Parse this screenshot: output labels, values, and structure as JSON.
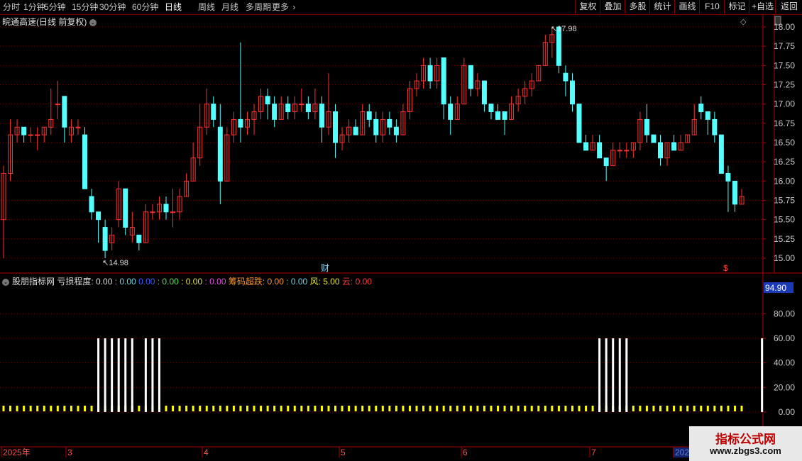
{
  "toolbar": {
    "left_tabs": [
      "分时",
      "1分钟",
      "5分钟",
      "15分钟",
      "30分钟",
      "60分钟",
      "日线",
      "周线",
      "月线",
      "多周期",
      "更多"
    ],
    "active_tab": "日线",
    "right_buttons": [
      "复权",
      "叠加",
      "多股",
      "统计",
      "画线",
      "F10",
      "标记",
      "+自选",
      "返回"
    ]
  },
  "main_chart": {
    "title": "皖通高速(日线 前复权)",
    "high_label": "17.98",
    "low_label": "14.98",
    "event_marker": "财",
    "dollar_marker": "$",
    "y_ticks": [
      "18.00",
      "17.75",
      "17.50",
      "17.25",
      "17.00",
      "16.75",
      "16.50",
      "16.25",
      "16.00",
      "15.75",
      "15.50",
      "15.25",
      "15.00"
    ]
  },
  "indicator": {
    "name": "股朋指标网",
    "items": [
      {
        "label": "亏损程度:",
        "value": "0.00",
        "color": "#dddddd"
      },
      {
        "label": ":",
        "value": "0.00",
        "color": "#6fd6e8"
      },
      {
        "label": "",
        "value": "0.00",
        "color": "#3b5cff"
      },
      {
        "label": ":",
        "value": "0.00",
        "color": "#5fdc5f"
      },
      {
        "label": ":",
        "value": "0.00",
        "color": "#e6e64a"
      },
      {
        "label": ":",
        "value": "0.00",
        "color": "#e04ae0"
      },
      {
        "label": "筹码超跌:",
        "value": "0.00",
        "color": "#ff9a2a"
      },
      {
        "label": ":",
        "value": "0.00",
        "color": "#6fd6e8"
      },
      {
        "label": "风:",
        "value": "5.00",
        "color": "#e6e64a"
      },
      {
        "label": "云:",
        "value": "0.00",
        "color": "#ff3a3a"
      }
    ],
    "current_value": "94.90",
    "y_ticks": [
      "80.00",
      "60.00",
      "40.00",
      "20.00",
      "0.00"
    ]
  },
  "x_axis": {
    "labels": [
      "2025年",
      "3",
      "4",
      "5",
      "6",
      "7",
      "202"
    ]
  },
  "watermark": {
    "title": "指标公式网",
    "url": "www.zbgs3.com"
  },
  "colors": {
    "up": "#ff3030",
    "down": "#54ffff",
    "grid": "#6a0000",
    "border": "#b00000",
    "spike": "#ffffff",
    "base_marker": "#ffff00"
  },
  "chart_data": {
    "type": "candlestick",
    "title": "皖通高速(日线 前复权)",
    "x_range": [
      "2025-01",
      "2025-07"
    ],
    "ylim": [
      14.9,
      18.1
    ],
    "candles": [
      [
        15.5,
        16.1,
        15.0,
        16.2
      ],
      [
        16.1,
        16.6,
        16.0,
        16.8
      ],
      [
        16.6,
        16.7,
        16.5,
        16.8
      ],
      [
        16.7,
        16.6,
        16.5,
        16.7
      ],
      [
        16.6,
        16.6,
        16.5,
        16.7
      ],
      [
        16.6,
        16.6,
        16.4,
        16.7
      ],
      [
        16.6,
        16.7,
        16.5,
        16.7
      ],
      [
        16.7,
        16.8,
        16.6,
        17.2
      ],
      [
        17.0,
        17.0,
        16.8,
        17.3
      ],
      [
        17.1,
        16.7,
        16.5,
        17.1
      ],
      [
        16.6,
        16.7,
        16.5,
        16.8
      ],
      [
        16.7,
        16.7,
        16.6,
        16.8
      ],
      [
        16.6,
        15.9,
        15.9,
        16.7
      ],
      [
        15.8,
        15.6,
        15.5,
        15.9
      ],
      [
        15.6,
        15.5,
        15.2,
        15.6
      ],
      [
        15.4,
        15.1,
        15.0,
        15.5
      ],
      [
        15.2,
        15.3,
        15.1,
        15.4
      ],
      [
        15.5,
        15.9,
        15.4,
        16.0
      ],
      [
        15.9,
        15.4,
        15.3,
        15.9
      ],
      [
        15.3,
        15.4,
        15.2,
        15.6
      ],
      [
        15.3,
        15.2,
        15.1,
        15.3
      ],
      [
        15.2,
        15.6,
        15.2,
        15.7
      ],
      [
        15.6,
        15.6,
        15.5,
        15.7
      ],
      [
        15.6,
        15.7,
        15.5,
        15.8
      ],
      [
        15.7,
        15.6,
        15.5,
        15.8
      ],
      [
        15.6,
        15.6,
        15.4,
        15.9
      ],
      [
        15.6,
        15.8,
        15.5,
        15.9
      ],
      [
        15.8,
        16.0,
        15.8,
        16.1
      ],
      [
        16.0,
        16.3,
        16.0,
        16.5
      ],
      [
        16.3,
        16.7,
        16.2,
        17.0
      ],
      [
        16.7,
        17.0,
        16.6,
        17.2
      ],
      [
        17.0,
        16.8,
        16.7,
        17.1
      ],
      [
        16.7,
        16.0,
        15.7,
        17.0
      ],
      [
        16.0,
        16.6,
        16.0,
        16.7
      ],
      [
        16.6,
        16.8,
        16.5,
        16.9
      ],
      [
        16.8,
        16.7,
        16.5,
        17.8
      ],
      [
        16.7,
        16.8,
        16.6,
        16.9
      ],
      [
        16.8,
        16.9,
        16.6,
        17.0
      ],
      [
        16.9,
        17.1,
        16.8,
        17.2
      ],
      [
        17.1,
        17.0,
        16.8,
        17.2
      ],
      [
        17.0,
        16.8,
        16.7,
        17.1
      ],
      [
        16.8,
        17.0,
        16.8,
        17.1
      ],
      [
        17.0,
        16.9,
        16.8,
        17.1
      ],
      [
        16.9,
        17.0,
        16.8,
        17.1
      ],
      [
        17.0,
        17.0,
        16.9,
        17.2
      ],
      [
        17.0,
        16.9,
        16.8,
        17.1
      ],
      [
        16.9,
        17.0,
        16.8,
        17.2
      ],
      [
        17.0,
        16.7,
        16.5,
        17.1
      ],
      [
        16.7,
        16.9,
        16.6,
        17.4
      ],
      [
        16.9,
        16.5,
        16.3,
        17.0
      ],
      [
        16.5,
        16.6,
        16.4,
        16.7
      ],
      [
        16.6,
        16.7,
        16.5,
        16.8
      ],
      [
        16.7,
        16.6,
        16.6,
        16.8
      ],
      [
        16.6,
        16.9,
        16.6,
        17.0
      ],
      [
        16.9,
        16.8,
        16.7,
        17.0
      ],
      [
        16.8,
        16.6,
        16.5,
        16.9
      ],
      [
        16.6,
        16.8,
        16.5,
        16.9
      ],
      [
        16.8,
        16.7,
        16.6,
        16.9
      ],
      [
        16.7,
        16.6,
        16.5,
        16.8
      ],
      [
        16.6,
        16.9,
        16.6,
        17.0
      ],
      [
        16.9,
        17.2,
        16.8,
        17.3
      ],
      [
        17.2,
        17.3,
        17.1,
        17.4
      ],
      [
        17.3,
        17.5,
        17.2,
        17.6
      ],
      [
        17.5,
        17.3,
        17.2,
        17.6
      ],
      [
        17.3,
        17.5,
        17.2,
        17.6
      ],
      [
        17.6,
        17.0,
        16.8,
        17.6
      ],
      [
        17.0,
        16.8,
        16.6,
        17.1
      ],
      [
        16.8,
        17.0,
        16.8,
        17.1
      ],
      [
        17.0,
        17.5,
        17.0,
        17.6
      ],
      [
        17.5,
        17.2,
        17.1,
        17.5
      ],
      [
        17.2,
        17.3,
        17.1,
        17.4
      ],
      [
        17.3,
        17.0,
        16.9,
        17.3
      ],
      [
        17.0,
        16.9,
        16.8,
        17.0
      ],
      [
        16.9,
        16.8,
        16.8,
        17.0
      ],
      [
        16.9,
        16.8,
        16.6,
        16.9
      ],
      [
        16.8,
        17.0,
        16.8,
        17.1
      ],
      [
        17.0,
        17.1,
        16.9,
        17.2
      ],
      [
        17.1,
        17.2,
        17.0,
        17.3
      ],
      [
        17.2,
        17.3,
        17.1,
        17.4
      ],
      [
        17.3,
        17.5,
        17.3,
        17.5
      ],
      [
        17.5,
        17.8,
        17.5,
        17.9
      ],
      [
        17.8,
        17.9,
        17.6,
        18.0
      ],
      [
        18.0,
        17.5,
        17.4,
        18.0
      ],
      [
        17.4,
        17.3,
        17.1,
        17.5
      ],
      [
        17.3,
        17.0,
        16.9,
        17.4
      ],
      [
        17.0,
        16.5,
        16.5,
        17.0
      ],
      [
        16.5,
        16.4,
        16.4,
        16.6
      ],
      [
        16.4,
        16.5,
        16.4,
        16.6
      ],
      [
        16.5,
        16.3,
        16.3,
        16.6
      ],
      [
        16.3,
        16.2,
        16.0,
        16.3
      ],
      [
        16.2,
        16.4,
        16.2,
        16.5
      ],
      [
        16.4,
        16.4,
        16.3,
        16.5
      ],
      [
        16.4,
        16.4,
        16.3,
        16.5
      ],
      [
        16.4,
        16.5,
        16.3,
        16.5
      ],
      [
        16.5,
        16.8,
        16.4,
        16.9
      ],
      [
        16.8,
        16.6,
        16.5,
        17.0
      ],
      [
        16.6,
        16.5,
        16.5,
        16.6
      ],
      [
        16.5,
        16.3,
        16.2,
        16.6
      ],
      [
        16.3,
        16.5,
        16.2,
        16.5
      ],
      [
        16.5,
        16.4,
        16.4,
        16.6
      ],
      [
        16.4,
        16.5,
        16.4,
        16.6
      ],
      [
        16.5,
        16.6,
        16.5,
        16.6
      ],
      [
        16.6,
        16.8,
        16.6,
        17.0
      ],
      [
        17.0,
        16.9,
        16.8,
        17.1
      ],
      [
        16.9,
        16.8,
        16.6,
        16.9
      ],
      [
        16.8,
        16.6,
        16.5,
        16.9
      ],
      [
        16.6,
        16.1,
        16.1,
        16.6
      ],
      [
        16.1,
        16.0,
        15.6,
        16.2
      ],
      [
        16.0,
        15.7,
        15.6,
        16.0
      ],
      [
        15.7,
        15.8,
        15.7,
        15.9
      ]
    ],
    "indicator_series": {
      "name": "股朋指标网",
      "ylim": [
        0,
        100
      ],
      "spikes": [
        {
          "date_index": 14,
          "value": 60
        },
        {
          "date_index": 15,
          "value": 60
        },
        {
          "date_index": 16,
          "value": 60
        },
        {
          "date_index": 17,
          "value": 60
        },
        {
          "date_index": 18,
          "value": 60
        },
        {
          "date_index": 19,
          "value": 60
        },
        {
          "date_index": 21,
          "value": 60
        },
        {
          "date_index": 22,
          "value": 60
        },
        {
          "date_index": 23,
          "value": 60
        },
        {
          "date_index": 88,
          "value": 60
        },
        {
          "date_index": 89,
          "value": 60
        },
        {
          "date_index": 90,
          "value": 60
        },
        {
          "date_index": 91,
          "value": 60
        },
        {
          "date_index": 92,
          "value": 60
        },
        {
          "date_index": 112,
          "value": 60
        }
      ],
      "baseline_value": 0
    }
  }
}
